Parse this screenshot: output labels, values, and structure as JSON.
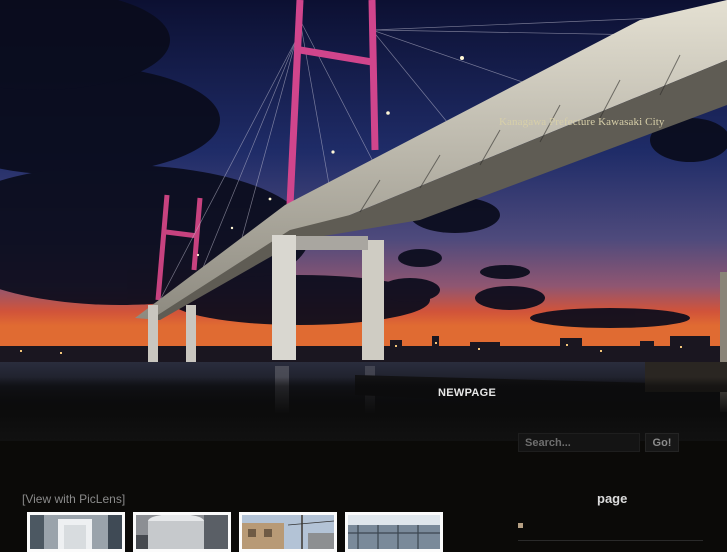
{
  "header": {
    "caption": "Kanagawa Prefecture Kawasaki City"
  },
  "nav": {
    "items": [
      "NEWPAGE"
    ]
  },
  "search": {
    "placeholder": "Search...",
    "button_label": "Go!"
  },
  "main": {
    "piclens_link": "[View with PicLens]",
    "thumbnails": [
      {
        "icon": "photo-tank-interior"
      },
      {
        "icon": "photo-water-tank"
      },
      {
        "icon": "photo-building-site"
      },
      {
        "icon": "photo-roof-frame"
      }
    ]
  },
  "sidebar": {
    "heading": "page"
  },
  "colors": {
    "page_background": "#0b0a08",
    "tower_accent": "#c9407f",
    "caption_text": "#d7cfa9",
    "bullet": "#b59f83"
  }
}
